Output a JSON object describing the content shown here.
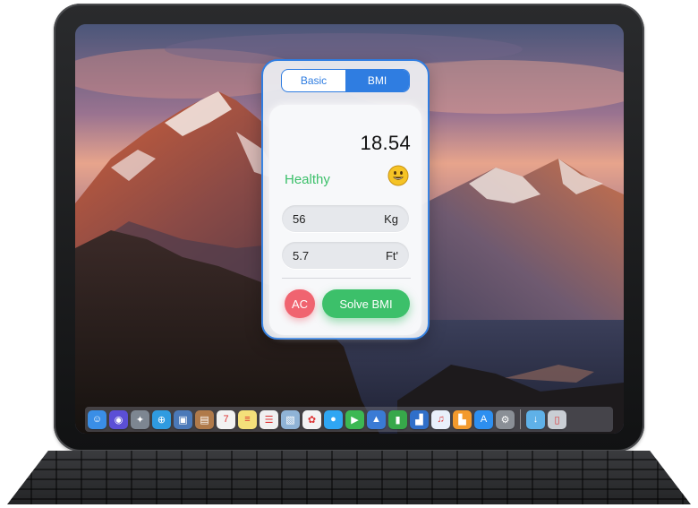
{
  "app": {
    "tabs": [
      {
        "label": "Basic",
        "active": false
      },
      {
        "label": "BMI",
        "active": true
      }
    ],
    "result": "18.54",
    "status": "Healthy",
    "status_icon": "smiley-face-icon",
    "fields": [
      {
        "value": "56",
        "unit": "Kg"
      },
      {
        "value": "5.7",
        "unit": "Ft'"
      }
    ],
    "buttons": {
      "clear": "AC",
      "solve": "Solve BMI"
    },
    "colors": {
      "accent": "#2f7de1",
      "healthy": "#3cc06a",
      "clear": "#f06470"
    }
  },
  "dock": {
    "icons": [
      {
        "name": "finder-icon",
        "glyph": "☺",
        "color": "#3a8ee6"
      },
      {
        "name": "siri-icon",
        "glyph": "◉",
        "color": "#5b4fd6"
      },
      {
        "name": "launchpad-icon",
        "glyph": "✦",
        "color": "#7d8691"
      },
      {
        "name": "safari-icon",
        "glyph": "⊕",
        "color": "#2f9be0"
      },
      {
        "name": "photo-browser-icon",
        "glyph": "▣",
        "color": "#4b79b8"
      },
      {
        "name": "contacts-icon",
        "glyph": "▤",
        "color": "#b07a4a"
      },
      {
        "name": "calendar-icon",
        "glyph": "7",
        "color": "#f2f2f2"
      },
      {
        "name": "notes-icon",
        "glyph": "≡",
        "color": "#f4e07a"
      },
      {
        "name": "reminders-icon",
        "glyph": "☰",
        "color": "#f0f0f0"
      },
      {
        "name": "preview-icon",
        "glyph": "▧",
        "color": "#8fb3d6"
      },
      {
        "name": "photos-icon",
        "glyph": "✿",
        "color": "#f3f3f3"
      },
      {
        "name": "messages-icon",
        "glyph": "●",
        "color": "#2fa6f3"
      },
      {
        "name": "facetime-icon",
        "glyph": "▶",
        "color": "#3cb853"
      },
      {
        "name": "keynote-icon",
        "glyph": "▲",
        "color": "#3a7bd5"
      },
      {
        "name": "numbers-icon",
        "glyph": "▮",
        "color": "#37a84a"
      },
      {
        "name": "presentation-icon",
        "glyph": "▟",
        "color": "#2f6fc9"
      },
      {
        "name": "itunes-icon",
        "glyph": "♫",
        "color": "#e9f0fb"
      },
      {
        "name": "ibooks-icon",
        "glyph": "▙",
        "color": "#f39a2d"
      },
      {
        "name": "app-store-icon",
        "glyph": "A",
        "color": "#2d8ff0"
      },
      {
        "name": "system-preferences-icon",
        "glyph": "⚙",
        "color": "#8a8f96"
      },
      {
        "name": "downloads-folder-icon",
        "glyph": "↓",
        "color": "#5fb1e8"
      },
      {
        "name": "trash-icon",
        "glyph": "▯",
        "color": "#c9ced4"
      }
    ]
  }
}
